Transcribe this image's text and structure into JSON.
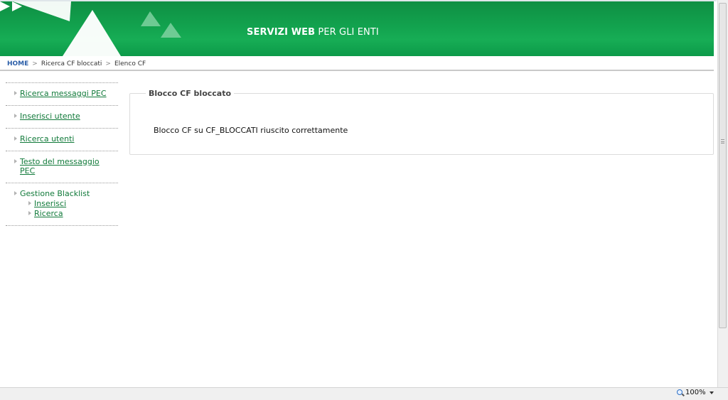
{
  "header": {
    "title_bold": "SERVIZI WEB",
    "title_rest": " PER GLI ENTI",
    "icons": [
      "play-arrows-icon"
    ],
    "colors": {
      "banner": "#12a24e",
      "link": "#117a3a",
      "home": "#2b5ea8"
    }
  },
  "breadcrumb": {
    "items": [
      "HOME",
      "Ricerca CF bloccati",
      "Elenco CF"
    ],
    "separator": ">"
  },
  "sidebar": {
    "items": [
      {
        "label": "Ricerca messaggi PEC"
      },
      {
        "label": "Inserisci utente"
      },
      {
        "label": "Ricerca utenti"
      },
      {
        "label": "Testo del messaggio PEC"
      },
      {
        "label": "Gestione Blacklist",
        "children": [
          "Inserisci",
          "Ricerca"
        ]
      }
    ]
  },
  "panel": {
    "legend": "Blocco CF bloccato",
    "message": "Blocco CF su CF_BLOCCATI riuscito correttamente"
  },
  "statusbar": {
    "zoom": "100%"
  }
}
